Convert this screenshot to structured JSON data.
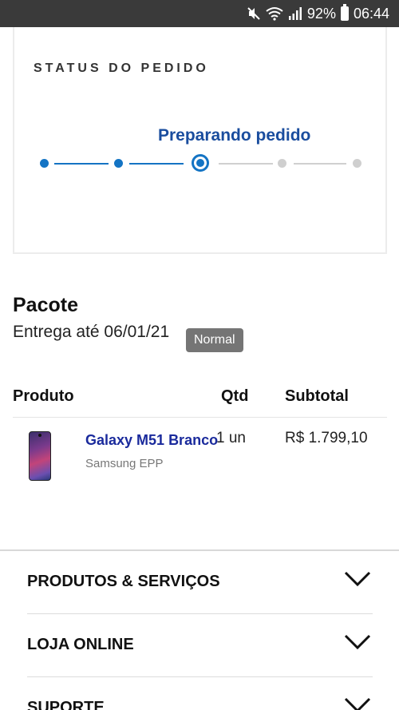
{
  "statusbar": {
    "battery": "92%",
    "time": "06:44",
    "icons": [
      "mute-icon",
      "wifi-icon",
      "signal-icon",
      "battery-icon"
    ]
  },
  "order_status": {
    "title": "STATUS DO PEDIDO",
    "current_step_label": "Preparando pedido",
    "total_steps": 5,
    "current_step": 3,
    "colors": {
      "done": "#1474c4",
      "pending": "#cfcfcf",
      "label": "#1a4d9e"
    }
  },
  "package": {
    "title": "Pacote",
    "delivery": "Entrega até 06/01/21",
    "shipping_badge": "Normal"
  },
  "items_table": {
    "headers": {
      "product": "Produto",
      "qty": "Qtd",
      "subtotal": "Subtotal"
    },
    "rows": [
      {
        "name": "Galaxy M51 Branco",
        "seller": "Samsung EPP",
        "qty": "1 un",
        "subtotal": "R$ 1.799,10"
      }
    ]
  },
  "footer_menu": {
    "items": [
      {
        "label": "PRODUTOS & SERVIÇOS"
      },
      {
        "label": "LOJA ONLINE"
      },
      {
        "label": "SUPORTE"
      }
    ]
  }
}
